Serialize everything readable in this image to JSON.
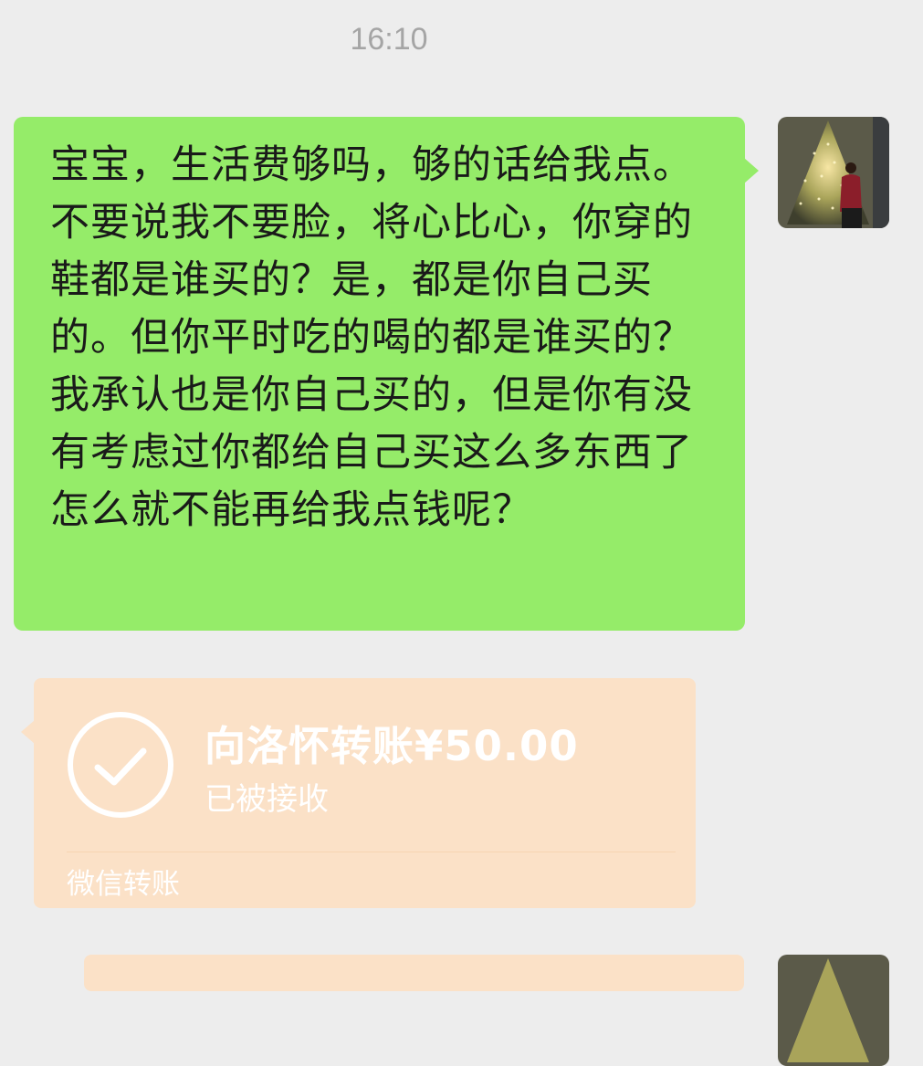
{
  "chat": {
    "timestamp": "16:10",
    "sent_message": "宝宝，生活费够吗，够的话给我点。不要说我不要脸，将心比心，你穿的鞋都是谁买的？是，都是你自己买的。但你平时吃的喝的都是谁买的？我承认也是你自己买的，但是你有没有考虑过你都给自己买这么多东西了怎么就不能再给我点钱呢？",
    "transfer": {
      "title": "向洛怀转账¥50.00",
      "status": "已被接收",
      "source": "微信转账",
      "icon": "check-circle-icon"
    },
    "avatar_icon": "user-avatar"
  },
  "colors": {
    "background": "#ededed",
    "sent_bubble": "#95ec69",
    "transfer_card": "#fbe1c7",
    "timestamp_text": "#a5a5a5"
  }
}
